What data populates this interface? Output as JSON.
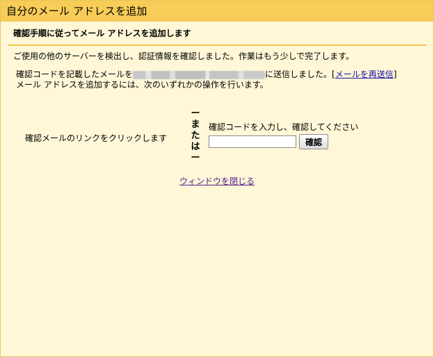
{
  "window": {
    "title": "自分のメール アドレスを追加"
  },
  "step": {
    "heading": "確認手順に従ってメール アドレスを追加します"
  },
  "info": {
    "text": "ご使用の他のサーバーを検出し、認証情報を確認しました。作業はもう少しで完了します。"
  },
  "sent": {
    "prefix": "確認コードを記載したメールを",
    "suffix": "に送信しました。[",
    "resend_label": "メールを再送信",
    "close_bracket": "]",
    "instructions": "メール アドレスを追加するには、次のいずれかの操作を行います。"
  },
  "methods": {
    "click_link_text": "確認メールのリンクをクリックします",
    "or_label": [
      "ー",
      "ま",
      "た",
      "は",
      "ー"
    ],
    "enter_code_label": "確認コードを入力し、確認してください",
    "code_input_value": "",
    "verify_button": "確認"
  },
  "footer": {
    "close_window": "ウィンドウを閉じる"
  },
  "colors": {
    "title_bar": "#f7cc57",
    "background": "#fff7d7",
    "divider": "#f4c34a",
    "link": "#1a0dab",
    "visited_link": "#551a8b"
  }
}
